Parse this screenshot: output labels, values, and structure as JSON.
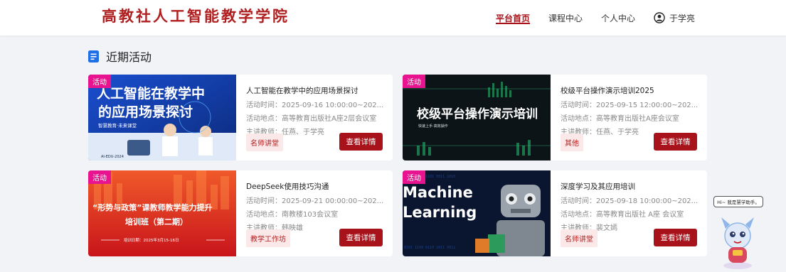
{
  "header": {
    "logo": "高教社人工智能教学学院",
    "nav": [
      "平台首页",
      "课程中心",
      "个人中心"
    ],
    "active_index": 0,
    "user_name": "于学亮",
    "user_icon": "user-circle-icon"
  },
  "section": {
    "title": "近期活动",
    "icon": "document-icon"
  },
  "cards": [
    {
      "tag": "活动",
      "thumb_lines": [
        "人工智能在教学中",
        "的应用场景探讨"
      ],
      "thumb_sub": "智慧教育·未来课堂",
      "thumb_foot": "AI-EDU-2024",
      "title": "人工智能在教学中的应用场景探讨",
      "time": "活动时间：2025-09-16 10:00:00~202...",
      "place": "活动地点：高等教育出版社A座2层会议室",
      "teacher": "主讲教师：任燕、于学亮",
      "badge": "名师讲堂",
      "button": "查看详情"
    },
    {
      "tag": "活动",
      "thumb_lines": [
        "校级平台操作演示培训"
      ],
      "thumb_sub": "快速上手·高效操作",
      "title": "校级平台操作演示培训2025",
      "time": "活动时间：2025-09-15 12:00:00~202...",
      "place": "活动地点：高等教育出版社A座会议室",
      "teacher": "主讲教师：任燕、于学亮",
      "badge": "其他",
      "button": "查看详情"
    },
    {
      "tag": "活动",
      "thumb_lines": [
        "“形势与政策”课教师教学能力提升",
        "培训班（第二期）"
      ],
      "thumb_foot": "培训日期：2025年3月15-16日",
      "title": "DeepSeek使用技巧沟通",
      "time": "活动时间：2025-09-21 00:00:00~202...",
      "place": "活动地点：南教楼103会议室",
      "teacher": "主讲教师：韩映雄",
      "badge": "教学工作坊",
      "button": "查看详情"
    },
    {
      "tag": "活动",
      "thumb_lines": [
        "Machine",
        "Learning"
      ],
      "title": "深度学习及其应用培训",
      "time": "活动时间：2025-09-18 10:00:00~202...",
      "place": "活动地点：高等教育出版社 A座 会议室",
      "teacher": "主讲教师：裴文嫣",
      "badge": "名师讲堂",
      "button": "查看详情"
    }
  ],
  "assistant": {
    "bubble": "Hi~ 我是慧学助手。",
    "icon": "mascot-dragon-icon"
  },
  "colors": {
    "brand_red": "#a8131b",
    "tag_pink": "#e8138f",
    "page_bg": "#f2f3f7"
  }
}
